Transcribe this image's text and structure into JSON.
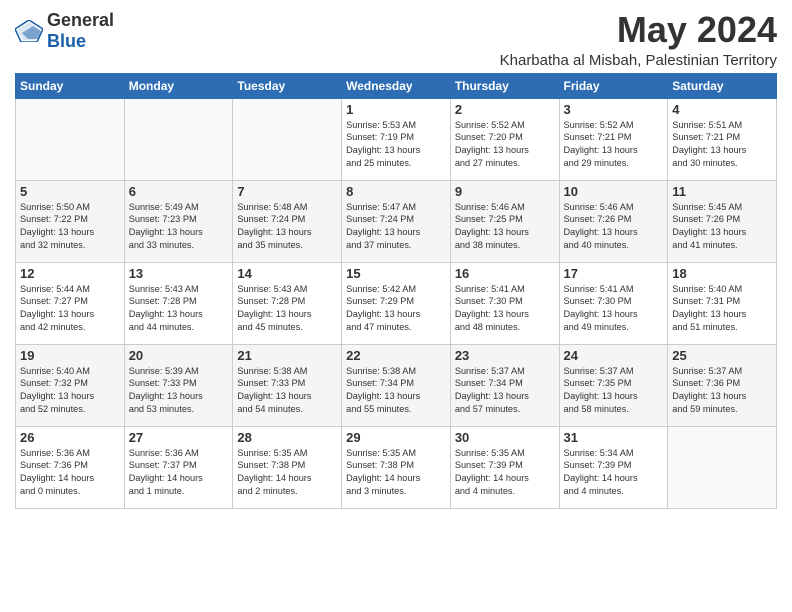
{
  "header": {
    "logo_general": "General",
    "logo_blue": "Blue",
    "month_title": "May 2024",
    "location": "Kharbatha al Misbah, Palestinian Territory"
  },
  "days_of_week": [
    "Sunday",
    "Monday",
    "Tuesday",
    "Wednesday",
    "Thursday",
    "Friday",
    "Saturday"
  ],
  "weeks": [
    [
      {
        "day": "",
        "info": ""
      },
      {
        "day": "",
        "info": ""
      },
      {
        "day": "",
        "info": ""
      },
      {
        "day": "1",
        "info": "Sunrise: 5:53 AM\nSunset: 7:19 PM\nDaylight: 13 hours\nand 25 minutes."
      },
      {
        "day": "2",
        "info": "Sunrise: 5:52 AM\nSunset: 7:20 PM\nDaylight: 13 hours\nand 27 minutes."
      },
      {
        "day": "3",
        "info": "Sunrise: 5:52 AM\nSunset: 7:21 PM\nDaylight: 13 hours\nand 29 minutes."
      },
      {
        "day": "4",
        "info": "Sunrise: 5:51 AM\nSunset: 7:21 PM\nDaylight: 13 hours\nand 30 minutes."
      }
    ],
    [
      {
        "day": "5",
        "info": "Sunrise: 5:50 AM\nSunset: 7:22 PM\nDaylight: 13 hours\nand 32 minutes."
      },
      {
        "day": "6",
        "info": "Sunrise: 5:49 AM\nSunset: 7:23 PM\nDaylight: 13 hours\nand 33 minutes."
      },
      {
        "day": "7",
        "info": "Sunrise: 5:48 AM\nSunset: 7:24 PM\nDaylight: 13 hours\nand 35 minutes."
      },
      {
        "day": "8",
        "info": "Sunrise: 5:47 AM\nSunset: 7:24 PM\nDaylight: 13 hours\nand 37 minutes."
      },
      {
        "day": "9",
        "info": "Sunrise: 5:46 AM\nSunset: 7:25 PM\nDaylight: 13 hours\nand 38 minutes."
      },
      {
        "day": "10",
        "info": "Sunrise: 5:46 AM\nSunset: 7:26 PM\nDaylight: 13 hours\nand 40 minutes."
      },
      {
        "day": "11",
        "info": "Sunrise: 5:45 AM\nSunset: 7:26 PM\nDaylight: 13 hours\nand 41 minutes."
      }
    ],
    [
      {
        "day": "12",
        "info": "Sunrise: 5:44 AM\nSunset: 7:27 PM\nDaylight: 13 hours\nand 42 minutes."
      },
      {
        "day": "13",
        "info": "Sunrise: 5:43 AM\nSunset: 7:28 PM\nDaylight: 13 hours\nand 44 minutes."
      },
      {
        "day": "14",
        "info": "Sunrise: 5:43 AM\nSunset: 7:28 PM\nDaylight: 13 hours\nand 45 minutes."
      },
      {
        "day": "15",
        "info": "Sunrise: 5:42 AM\nSunset: 7:29 PM\nDaylight: 13 hours\nand 47 minutes."
      },
      {
        "day": "16",
        "info": "Sunrise: 5:41 AM\nSunset: 7:30 PM\nDaylight: 13 hours\nand 48 minutes."
      },
      {
        "day": "17",
        "info": "Sunrise: 5:41 AM\nSunset: 7:30 PM\nDaylight: 13 hours\nand 49 minutes."
      },
      {
        "day": "18",
        "info": "Sunrise: 5:40 AM\nSunset: 7:31 PM\nDaylight: 13 hours\nand 51 minutes."
      }
    ],
    [
      {
        "day": "19",
        "info": "Sunrise: 5:40 AM\nSunset: 7:32 PM\nDaylight: 13 hours\nand 52 minutes."
      },
      {
        "day": "20",
        "info": "Sunrise: 5:39 AM\nSunset: 7:33 PM\nDaylight: 13 hours\nand 53 minutes."
      },
      {
        "day": "21",
        "info": "Sunrise: 5:38 AM\nSunset: 7:33 PM\nDaylight: 13 hours\nand 54 minutes."
      },
      {
        "day": "22",
        "info": "Sunrise: 5:38 AM\nSunset: 7:34 PM\nDaylight: 13 hours\nand 55 minutes."
      },
      {
        "day": "23",
        "info": "Sunrise: 5:37 AM\nSunset: 7:34 PM\nDaylight: 13 hours\nand 57 minutes."
      },
      {
        "day": "24",
        "info": "Sunrise: 5:37 AM\nSunset: 7:35 PM\nDaylight: 13 hours\nand 58 minutes."
      },
      {
        "day": "25",
        "info": "Sunrise: 5:37 AM\nSunset: 7:36 PM\nDaylight: 13 hours\nand 59 minutes."
      }
    ],
    [
      {
        "day": "26",
        "info": "Sunrise: 5:36 AM\nSunset: 7:36 PM\nDaylight: 14 hours\nand 0 minutes."
      },
      {
        "day": "27",
        "info": "Sunrise: 5:36 AM\nSunset: 7:37 PM\nDaylight: 14 hours\nand 1 minute."
      },
      {
        "day": "28",
        "info": "Sunrise: 5:35 AM\nSunset: 7:38 PM\nDaylight: 14 hours\nand 2 minutes."
      },
      {
        "day": "29",
        "info": "Sunrise: 5:35 AM\nSunset: 7:38 PM\nDaylight: 14 hours\nand 3 minutes."
      },
      {
        "day": "30",
        "info": "Sunrise: 5:35 AM\nSunset: 7:39 PM\nDaylight: 14 hours\nand 4 minutes."
      },
      {
        "day": "31",
        "info": "Sunrise: 5:34 AM\nSunset: 7:39 PM\nDaylight: 14 hours\nand 4 minutes."
      },
      {
        "day": "",
        "info": ""
      }
    ]
  ]
}
